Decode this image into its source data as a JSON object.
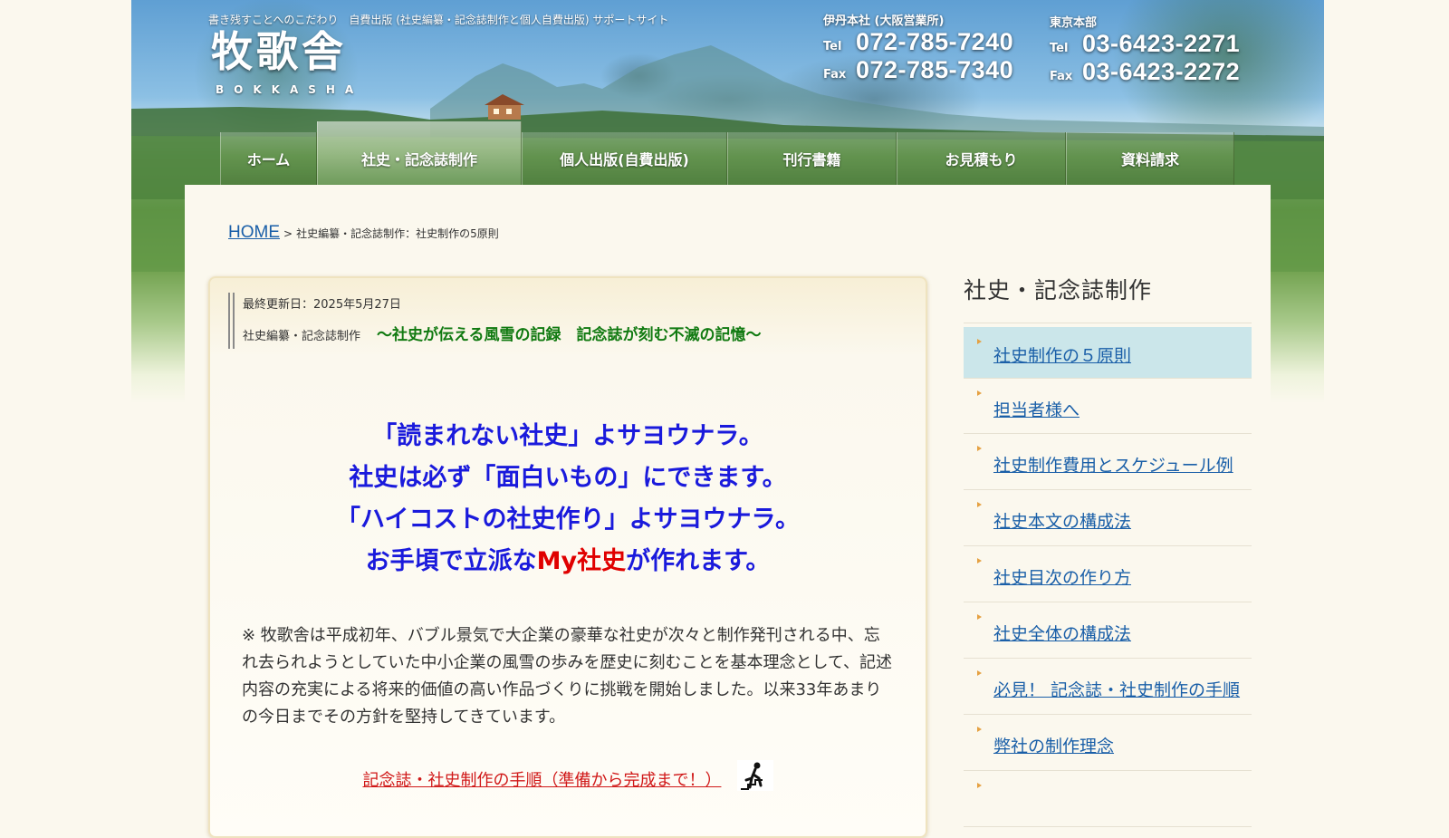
{
  "site": {
    "tagline": "書き残すことへのこだわり　自費出版 (社史編纂・記念誌制作と個人自費出版) サポートサイト",
    "logo_kanji": "牧歌舎",
    "logo_romaji": "BOKKASHA"
  },
  "offices": [
    {
      "name": "伊丹本社 (大阪営業所)",
      "tel_label": "Tel",
      "tel": "072-785-7240",
      "fax_label": "Fax",
      "fax": "072-785-7340"
    },
    {
      "name": "東京本部",
      "tel_label": "Tel",
      "tel": "03-6423-2271",
      "fax_label": "Fax",
      "fax": "03-6423-2272"
    }
  ],
  "nav": [
    {
      "label": "ホーム"
    },
    {
      "label": "社史・記念誌制作"
    },
    {
      "label": "個人出版(自費出版)"
    },
    {
      "label": "刊行書籍"
    },
    {
      "label": "お見積もり"
    },
    {
      "label": "資料請求"
    }
  ],
  "breadcrumb": {
    "home": "HOME",
    "separator": ">",
    "current": "社史編纂・記念誌制作：社史制作の5原則"
  },
  "article": {
    "updated": "最終更新日：2025年5月27日",
    "category": "社史編纂・記念誌制作",
    "subtitle": "〜社史が伝える風雪の記録　記念誌が刻む不滅の記憶〜",
    "lead": {
      "line1": "「読まれない社史」よサヨウナラ。",
      "line2": "社史は必ず「面白いもの」にできます。",
      "line3": "「ハイコストの社史作り」よサヨウナラ。",
      "line4_a": "お手頃で立派な",
      "line4_red": "My社史",
      "line4_b": "が作れます。"
    },
    "intro": "※ 牧歌舎は平成初年、バブル景気で大企業の豪華な社史が次々と制作発刊される中、忘れ去られようとしていた中小企業の風雪の歩みを歴史に刻むことを基本理念として、記述内容の充実による将来的価値の高い作品づくりに挑戦を開始しました。以来33年あまりの今日までその方針を堅持してきています。",
    "steps_link": "記念誌・社史制作の手順（準備から完成まで！）"
  },
  "sidebar": {
    "title": "社史・記念誌制作",
    "items": [
      {
        "label": "社史制作の５原則"
      },
      {
        "label": "担当者様へ"
      },
      {
        "label": "社史制作費用とスケジュール例"
      },
      {
        "label": "社史本文の構成法"
      },
      {
        "label": "社史目次の作り方"
      },
      {
        "label": "社史全体の構成法"
      },
      {
        "label": "必見！ 記念誌・社史制作の手順"
      },
      {
        "label": "弊社の制作理念"
      }
    ]
  },
  "colors": {
    "link": "#1a5fa8",
    "lead_blue": "#1a1adc",
    "lead_red": "#e00000",
    "subtitle_green": "#117a11",
    "sidebar_active": "#cbe6ea",
    "bullet": "#e5a142"
  }
}
